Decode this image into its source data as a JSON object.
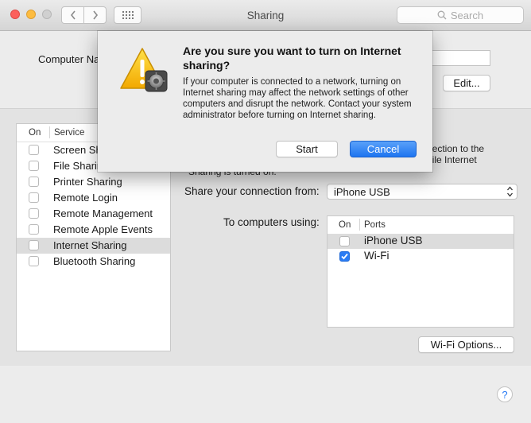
{
  "window": {
    "title": "Sharing",
    "search_placeholder": "Search"
  },
  "computer_name": {
    "label": "Computer Na",
    "edit_label": "Edit..."
  },
  "services": {
    "header_on": "On",
    "header_service": "Service",
    "items": [
      {
        "label": "Screen Sh",
        "checked": false,
        "selected": false
      },
      {
        "label": "File Sharin",
        "checked": false,
        "selected": false
      },
      {
        "label": "Printer Sharing",
        "checked": false,
        "selected": false
      },
      {
        "label": "Remote Login",
        "checked": false,
        "selected": false
      },
      {
        "label": "Remote Management",
        "checked": false,
        "selected": false
      },
      {
        "label": "Remote Apple Events",
        "checked": false,
        "selected": false
      },
      {
        "label": "Internet Sharing",
        "checked": false,
        "selected": true
      },
      {
        "label": "Bluetooth Sharing",
        "checked": false,
        "selected": false
      }
    ]
  },
  "detail": {
    "desc_line1": "nection to the",
    "desc_line2": "hile Internet",
    "desc_line3": "Sharing is turned on.",
    "share_from_label": "Share your connection from:",
    "share_from_value": "iPhone USB",
    "to_computers_label": "To computers using:",
    "ports_header_on": "On",
    "ports_header_ports": "Ports",
    "ports": [
      {
        "label": "iPhone USB",
        "checked": false,
        "selected": true
      },
      {
        "label": "Wi-Fi",
        "checked": true,
        "selected": false
      }
    ],
    "wifi_options_label": "Wi-Fi Options...",
    "help_label": "?"
  },
  "dialog": {
    "title": "Are you sure you want to turn on Internet sharing?",
    "message": "If your computer is connected to a network, turning on Internet sharing may affect the network settings of other computers and disrupt the network. Contact your system administrator before turning on Internet sharing.",
    "start_label": "Start",
    "cancel_label": "Cancel"
  },
  "colors": {
    "accent": "#2a7cf4",
    "close": "#fc605c",
    "minimize": "#fdbc40"
  }
}
